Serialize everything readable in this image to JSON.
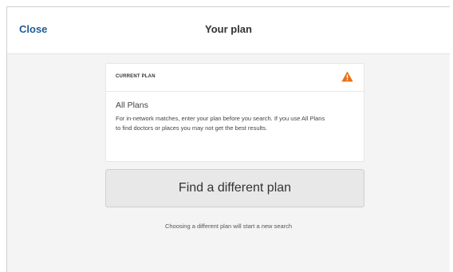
{
  "header": {
    "close_label": "Close",
    "title": "Your plan"
  },
  "card": {
    "label": "CURRENT PLAN",
    "warning_icon": "warning-triangle-icon",
    "warning_color": "#e8701a",
    "plan_name": "All Plans",
    "description": "For in-network matches, enter your plan before you search. If you use All Plans to find doctors or places you may not get the best results."
  },
  "action": {
    "button_label": "Find a different plan",
    "note": "Choosing a different plan will start a new search"
  },
  "colors": {
    "accent": "#1f5c99",
    "background": "#f4f4f4",
    "button_bg": "#e8e8e8"
  }
}
